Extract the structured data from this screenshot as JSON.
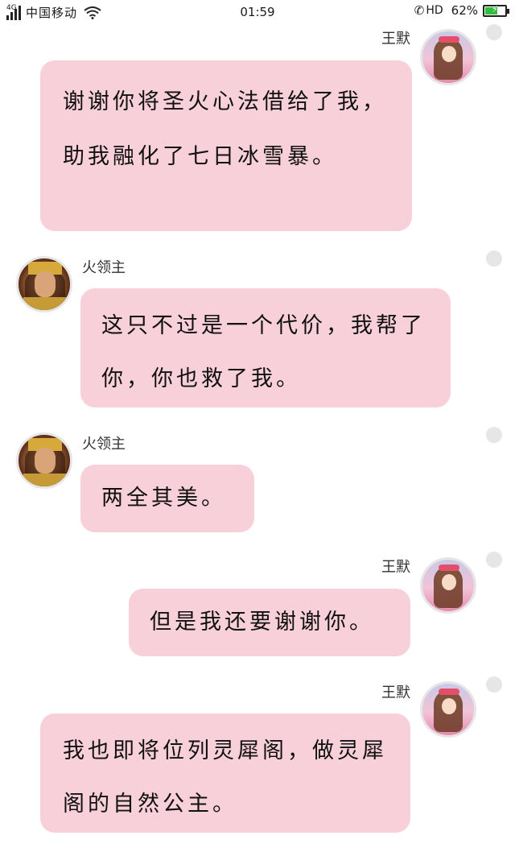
{
  "status_bar": {
    "network": "4G",
    "carrier": "中国移动",
    "time": "01:59",
    "hd": "HD",
    "battery_text": "62%",
    "battery_level": 0.62,
    "battery_color": "#2fbf3a"
  },
  "messages": [
    {
      "side": "right",
      "sender": "王默",
      "avatar": "girl-avatar",
      "text": "谢谢你将圣火心法借给了我，助我融化了七日冰雪暴。"
    },
    {
      "side": "left",
      "sender": "火领主",
      "avatar": "fire-lord-avatar",
      "text": "这只不过是一个代价，我帮了你，你也救了我。"
    },
    {
      "side": "left",
      "sender": "火领主",
      "avatar": "fire-lord-avatar",
      "text": "两全其美。"
    },
    {
      "side": "right",
      "sender": "王默",
      "avatar": "girl-avatar",
      "text": "但是我还要谢谢你。"
    },
    {
      "side": "right",
      "sender": "王默",
      "avatar": "girl-avatar",
      "text": "我也即将位列灵犀阁，做灵犀阁的自然公主。"
    }
  ],
  "colors": {
    "bubble": "#f8d0d9",
    "background": "#ffffff"
  }
}
